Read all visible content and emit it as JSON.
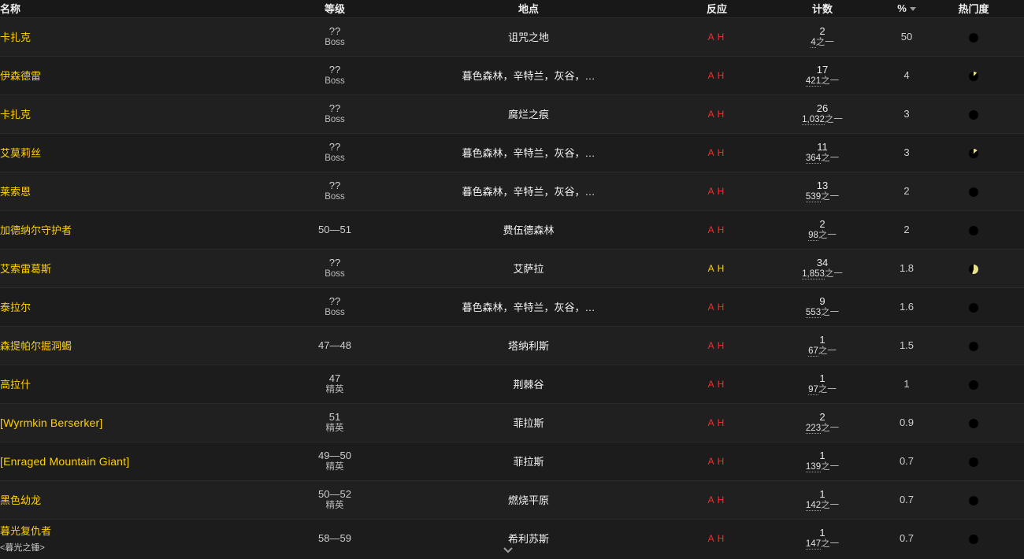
{
  "headers": {
    "name": "名称",
    "level": "等级",
    "location": "地点",
    "react": "反应",
    "count": "计数",
    "percent": "%",
    "popularity": "热门度"
  },
  "colors": {
    "name": "#ffd100",
    "hostile": "#ff2a2a",
    "neutral": "#ffd100",
    "pie_fill": "#e8e08a"
  },
  "rows": [
    {
      "name": "卡扎克",
      "title": "",
      "level": "??",
      "level_sub": "Boss",
      "location": "诅咒之地",
      "a": "A",
      "h": "H",
      "react_color": "#ff2a2a",
      "count": "2",
      "total": "4",
      "of": "之一",
      "pct": "50",
      "pop": 0
    },
    {
      "name": "伊森德雷",
      "title": "",
      "level": "??",
      "level_sub": "Boss",
      "location": "暮色森林，辛特兰，灰谷，…",
      "a": "A",
      "h": "H",
      "react_color": "#ff2a2a",
      "count": "17",
      "total": "421",
      "of": "之一",
      "pct": "4",
      "pop": 0.12
    },
    {
      "name": "卡扎克",
      "title": "",
      "level": "??",
      "level_sub": "Boss",
      "location": "腐烂之痕",
      "a": "A",
      "h": "H",
      "react_color": "#ff2a2a",
      "count": "26",
      "total": "1,032",
      "of": "之一",
      "pct": "3",
      "pop": 0
    },
    {
      "name": "艾莫莉丝",
      "title": "",
      "level": "??",
      "level_sub": "Boss",
      "location": "暮色森林，辛特兰，灰谷，…",
      "a": "A",
      "h": "H",
      "react_color": "#ff2a2a",
      "count": "11",
      "total": "364",
      "of": "之一",
      "pct": "3",
      "pop": 0.14
    },
    {
      "name": "莱索恩",
      "title": "",
      "level": "??",
      "level_sub": "Boss",
      "location": "暮色森林，辛特兰，灰谷，…",
      "a": "A",
      "h": "H",
      "react_color": "#ff2a2a",
      "count": "13",
      "total": "539",
      "of": "之一",
      "pct": "2",
      "pop": 0
    },
    {
      "name": "加德纳尔守护者",
      "title": "",
      "level": "50—51",
      "level_sub": "",
      "location": "费伍德森林",
      "a": "A",
      "h": "H",
      "react_color": "#ff2a2a",
      "count": "2",
      "total": "98",
      "of": "之一",
      "pct": "2",
      "pop": 0
    },
    {
      "name": "艾索雷葛斯",
      "title": "",
      "level": "??",
      "level_sub": "Boss",
      "location": "艾萨拉",
      "a": "A",
      "h": "H",
      "react_color": "#ffd100",
      "count": "34",
      "total": "1,853",
      "of": "之一",
      "pct": "1.8",
      "pop": 0.55
    },
    {
      "name": "泰拉尔",
      "title": "",
      "level": "??",
      "level_sub": "Boss",
      "location": "暮色森林，辛特兰，灰谷，…",
      "a": "A",
      "h": "H",
      "react_color": "#ff2a2a",
      "count": "9",
      "total": "553",
      "of": "之一",
      "pct": "1.6",
      "pop": 0
    },
    {
      "name": "森提帕尔掘洞蝎",
      "title": "",
      "level": "47—48",
      "level_sub": "",
      "location": "塔纳利斯",
      "a": "A",
      "h": "H",
      "react_color": "#ff2a2a",
      "count": "1",
      "total": "67",
      "of": "之一",
      "pct": "1.5",
      "pop": 0
    },
    {
      "name": "高拉什",
      "title": "",
      "level": "47",
      "level_sub": "精英",
      "location": "荆棘谷",
      "a": "A",
      "h": "H",
      "react_color": "#ff2a2a",
      "count": "1",
      "total": "97",
      "of": "之一",
      "pct": "1",
      "pop": 0
    },
    {
      "name": "[Wyrmkin Berserker]",
      "title": "",
      "level": "51",
      "level_sub": "精英",
      "location": "菲拉斯",
      "a": "A",
      "h": "H",
      "react_color": "#ff2a2a",
      "count": "2",
      "total": "223",
      "of": "之一",
      "pct": "0.9",
      "pop": 0
    },
    {
      "name": "[Enraged Mountain Giant]",
      "title": "",
      "level": "49—50",
      "level_sub": "精英",
      "location": "菲拉斯",
      "a": "A",
      "h": "H",
      "react_color": "#ff2a2a",
      "count": "1",
      "total": "139",
      "of": "之一",
      "pct": "0.7",
      "pop": 0
    },
    {
      "name": "黑色幼龙",
      "title": "",
      "level": "50—52",
      "level_sub": "精英",
      "location": "燃烧平原",
      "a": "A",
      "h": "H",
      "react_color": "#ff2a2a",
      "count": "1",
      "total": "142",
      "of": "之一",
      "pct": "0.7",
      "pop": 0
    },
    {
      "name": "暮光复仇者",
      "title": "<暮光之锤>",
      "level": "58—59",
      "level_sub": "",
      "location": "希利苏斯",
      "a": "A",
      "h": "H",
      "react_color": "#ff2a2a",
      "count": "1",
      "total": "147",
      "of": "之一",
      "pct": "0.7",
      "pop": 0
    }
  ],
  "icons": {
    "sort": "sort-desc-icon",
    "more": "chevron-down-icon",
    "popularity": "pie-icon"
  }
}
